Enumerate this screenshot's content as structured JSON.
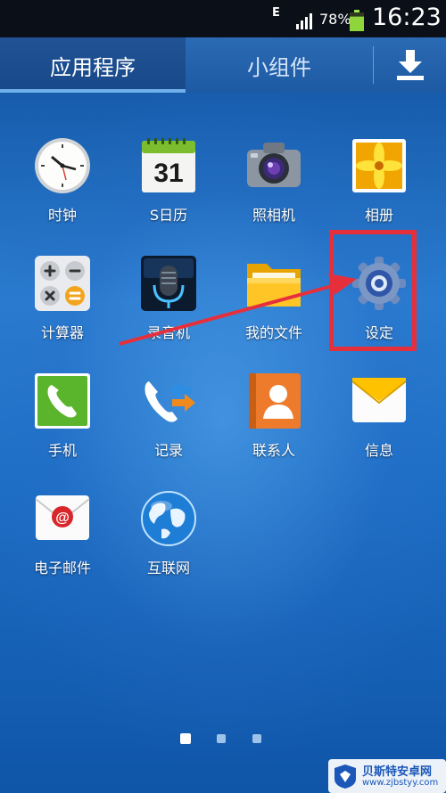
{
  "status_bar": {
    "network_type": "E",
    "battery_percent": "78%",
    "battery_level": 0.78,
    "time": "16:23"
  },
  "tabs": {
    "apps": "应用程序",
    "widgets": "小组件",
    "download_icon": "download-icon"
  },
  "apps": [
    {
      "label": "时钟",
      "icon": "clock-icon"
    },
    {
      "label": "S日历",
      "icon": "calendar-icon",
      "calendar_day": "31"
    },
    {
      "label": "照相机",
      "icon": "camera-icon"
    },
    {
      "label": "相册",
      "icon": "gallery-icon"
    },
    {
      "label": "计算器",
      "icon": "calculator-icon"
    },
    {
      "label": "录音机",
      "icon": "voice-recorder-icon"
    },
    {
      "label": "我的文件",
      "icon": "folder-icon"
    },
    {
      "label": "设定",
      "icon": "settings-gear-icon"
    },
    {
      "label": "手机",
      "icon": "phone-icon"
    },
    {
      "label": "记录",
      "icon": "call-log-icon"
    },
    {
      "label": "联系人",
      "icon": "contacts-icon"
    },
    {
      "label": "信息",
      "icon": "messages-icon"
    },
    {
      "label": "电子邮件",
      "icon": "email-icon"
    },
    {
      "label": "互联网",
      "icon": "internet-globe-icon"
    }
  ],
  "page_indicator": {
    "pages": 3,
    "current": 1
  },
  "annotation": {
    "color": "#e5303c",
    "target": "设定"
  },
  "watermark": {
    "title": "贝斯特安卓网",
    "url": "www.zjbstyy.com"
  }
}
